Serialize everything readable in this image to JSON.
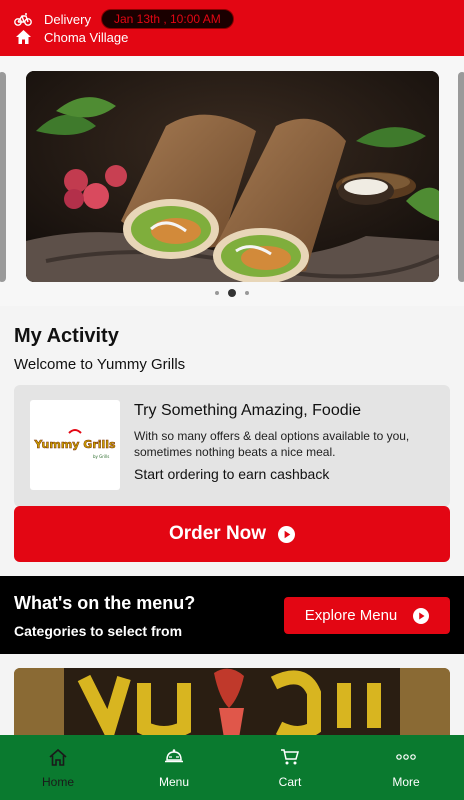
{
  "header": {
    "mode_label": "Delivery",
    "time_label": "Jan 13th , 10:00 AM",
    "location_label": "Choma Village",
    "accent": "#e30613"
  },
  "carousel": {
    "slides": 3,
    "active_index": 1
  },
  "activity": {
    "title": "My Activity",
    "subtitle": "Welcome to Yummy Grills"
  },
  "promo": {
    "logo_text": "Yummy Grills",
    "title": "Try Something Amazing, Foodie",
    "description": "With so many offers & deal options available to you, sometimes nothing beats a nice meal.",
    "cta": "Start ordering to earn cashback"
  },
  "order_button": {
    "label": "Order Now"
  },
  "menu_banner": {
    "title": "What's on the menu?",
    "subtitle": "Categories to select from",
    "button_label": "Explore Menu"
  },
  "bottom_nav": {
    "items": [
      {
        "label": "Home",
        "icon": "home-icon"
      },
      {
        "label": "Menu",
        "icon": "food-cloche-icon"
      },
      {
        "label": "Cart",
        "icon": "cart-icon"
      },
      {
        "label": "More",
        "icon": "more-dots-icon"
      }
    ],
    "background": "#0a7a2f"
  }
}
